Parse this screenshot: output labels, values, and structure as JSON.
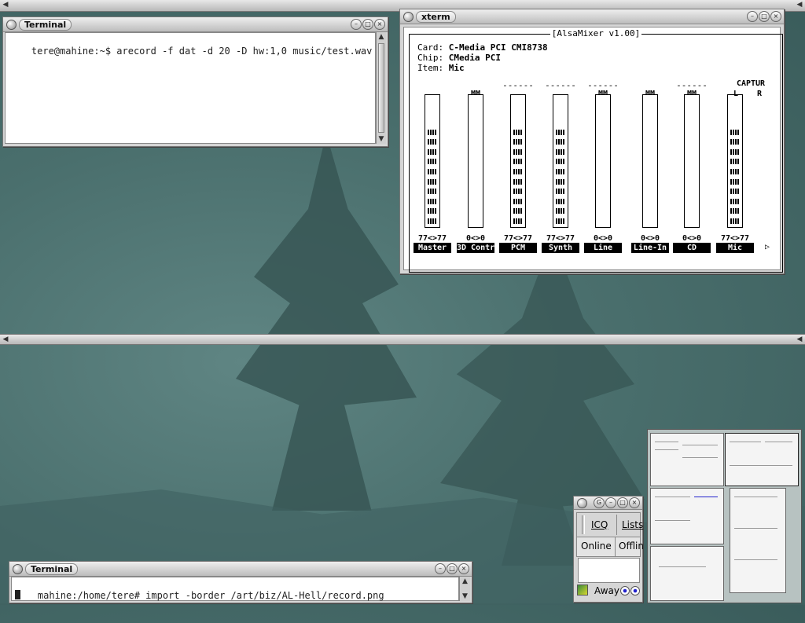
{
  "terminal_top": {
    "title": "Terminal",
    "prompt_line": "tere@mahine:~$ arecord -f dat -d 20 -D hw:1,0 music/test.wav ▯"
  },
  "terminal_bottom": {
    "title": "Terminal",
    "prompt_line": "mahine:/home/tere# import -border /art/biz/AL-Hell/record.png"
  },
  "xterm": {
    "title": "xterm",
    "alsamixer": {
      "title": "[AlsaMixer v1.00]",
      "card_label": "Card:",
      "card": "C-Media PCI CMI8738",
      "chip_label": "Chip:",
      "chip": "CMedia PCI",
      "item_label": "Item:",
      "item": "Mic",
      "channels": [
        {
          "name": "Master",
          "value": "77<>77",
          "level": 77,
          "dash": "",
          "mm": ""
        },
        {
          "name": "3D Contr",
          "value": "0<>0",
          "level": 0,
          "dash": "",
          "mm": "MM"
        },
        {
          "name": "PCM",
          "value": "77<>77",
          "level": 77,
          "dash": "------",
          "mm": ""
        },
        {
          "name": "Synth",
          "value": "77<>77",
          "level": 77,
          "dash": "------",
          "mm": ""
        },
        {
          "name": "Line",
          "value": "0<>0",
          "level": 0,
          "dash": "------",
          "mm": "MM"
        },
        {
          "name": "Line-In",
          "value": "0<>0",
          "level": 0,
          "dash": "",
          "mm": "MM"
        },
        {
          "name": "CD",
          "value": "0<>0",
          "level": 0,
          "dash": "------",
          "mm": "MM"
        },
        {
          "name": "Mic",
          "value": "77<>77",
          "level": 77,
          "dash": "",
          "mm": ""
        }
      ],
      "capture_label": "CAPTUR",
      "capture_l": "L",
      "capture_r": "R"
    }
  },
  "gaim": {
    "tab_icq": "ICQ",
    "tab_lists": "Lists",
    "tab_online": "Online",
    "tab_offline": "Offlin",
    "away_label": "Away"
  },
  "icons": {
    "window_menu": "circle-button-icon",
    "minimize": "minimize-icon",
    "maximize": "maximize-icon",
    "close": "close-icon"
  }
}
